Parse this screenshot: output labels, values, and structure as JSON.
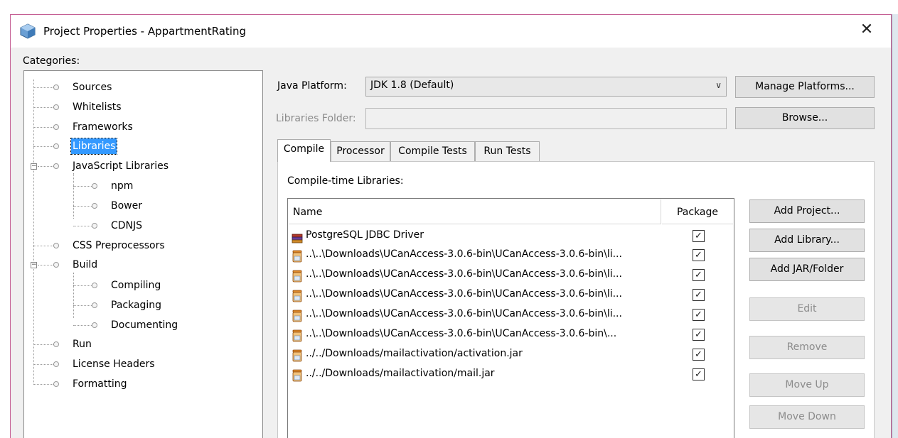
{
  "window": {
    "title": "Project Properties - AppartmentRating",
    "close_glyph": "✕"
  },
  "categories": {
    "label": "Categories:",
    "items": [
      {
        "label": "Sources",
        "selected": false
      },
      {
        "label": "Whitelists",
        "selected": false
      },
      {
        "label": "Frameworks",
        "selected": false
      },
      {
        "label": "Libraries",
        "selected": true
      },
      {
        "label": "JavaScript Libraries",
        "selected": false,
        "expanded": true
      },
      {
        "label": "npm",
        "selected": false
      },
      {
        "label": "Bower",
        "selected": false
      },
      {
        "label": "CDNJS",
        "selected": false
      },
      {
        "label": "CSS Preprocessors",
        "selected": false
      },
      {
        "label": "Build",
        "selected": false,
        "expanded": true
      },
      {
        "label": "Compiling",
        "selected": false
      },
      {
        "label": "Packaging",
        "selected": false
      },
      {
        "label": "Documenting",
        "selected": false
      },
      {
        "label": "Run",
        "selected": false
      },
      {
        "label": "License Headers",
        "selected": false
      },
      {
        "label": "Formatting",
        "selected": false
      }
    ]
  },
  "platform": {
    "label": "Java Platform:",
    "value": "JDK 1.8 (Default)",
    "manage_button": "Manage Platforms..."
  },
  "libraries_folder": {
    "label": "Libraries Folder:",
    "value": "",
    "browse_button": "Browse..."
  },
  "tabs": [
    {
      "label": "Compile",
      "active": true
    },
    {
      "label": "Processor",
      "active": false
    },
    {
      "label": "Compile Tests",
      "active": false
    },
    {
      "label": "Run Tests",
      "active": false
    }
  ],
  "compile": {
    "section_label": "Compile-time Libraries:",
    "columns": {
      "name": "Name",
      "package": "Package"
    },
    "rows": [
      {
        "name": "PostgreSQL JDBC Driver",
        "icon": "library-books-icon",
        "package": true
      },
      {
        "name": "..\\..\\Downloads\\UCanAccess-3.0.6-bin\\UCanAccess-3.0.6-bin\\li...",
        "icon": "jar-file-icon",
        "package": true
      },
      {
        "name": "..\\..\\Downloads\\UCanAccess-3.0.6-bin\\UCanAccess-3.0.6-bin\\li...",
        "icon": "jar-file-icon",
        "package": true
      },
      {
        "name": "..\\..\\Downloads\\UCanAccess-3.0.6-bin\\UCanAccess-3.0.6-bin\\li...",
        "icon": "jar-file-icon",
        "package": true
      },
      {
        "name": "..\\..\\Downloads\\UCanAccess-3.0.6-bin\\UCanAccess-3.0.6-bin\\li...",
        "icon": "jar-file-icon",
        "package": true
      },
      {
        "name": "..\\..\\Downloads\\UCanAccess-3.0.6-bin\\UCanAccess-3.0.6-bin\\...",
        "icon": "jar-file-icon",
        "package": true
      },
      {
        "name": "../../Downloads/mailactivation/activation.jar",
        "icon": "jar-file-icon",
        "package": true
      },
      {
        "name": "../../Downloads/mailactivation/mail.jar",
        "icon": "jar-file-icon",
        "package": true
      }
    ],
    "check_glyph": "✓",
    "buttons": {
      "add_project": "Add Project...",
      "add_library": "Add Library...",
      "add_jar": "Add JAR/Folder",
      "edit": "Edit",
      "remove": "Remove",
      "move_up": "Move Up",
      "move_down": "Move Down"
    }
  }
}
